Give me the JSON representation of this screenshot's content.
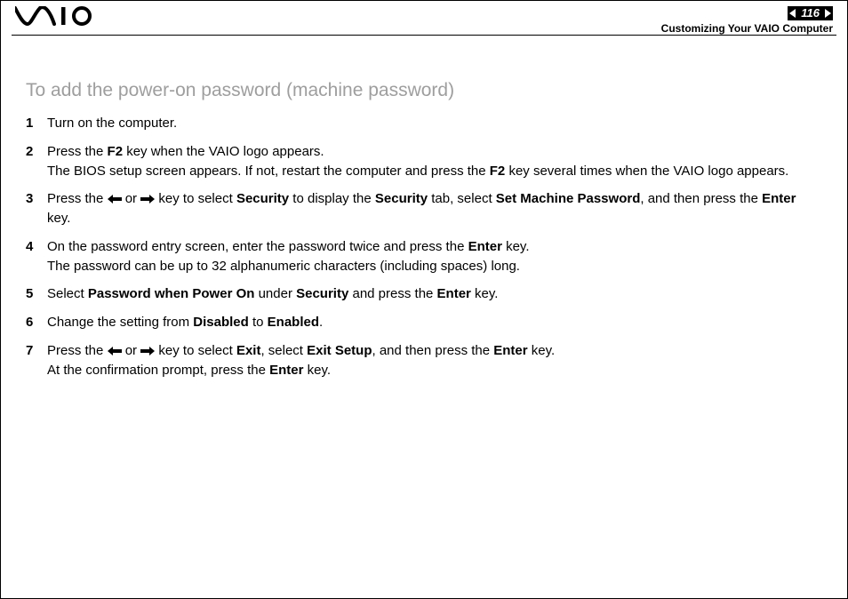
{
  "header": {
    "page_number": "116",
    "section": "Customizing Your VAIO Computer"
  },
  "title": "To add the power-on password (machine password)",
  "steps": {
    "s1": {
      "num": "1",
      "text": "Turn on the computer."
    },
    "s2": {
      "num": "2",
      "line1_a": "Press the ",
      "line1_key": "F2",
      "line1_b": " key when the VAIO logo appears.",
      "line2_a": "The BIOS setup screen appears. If not, restart the computer and press the ",
      "line2_key": "F2",
      "line2_b": " key several times when the VAIO logo appears."
    },
    "s3": {
      "num": "3",
      "a": "Press the ",
      "or": " or ",
      "b": " key to select ",
      "k1": "Security",
      "c": " to display the ",
      "k2": "Security",
      "d": " tab, select ",
      "k3": "Set Machine Password",
      "e": ", and then press the ",
      "k4": "Enter",
      "f": " key."
    },
    "s4": {
      "num": "4",
      "a": "On the password entry screen, enter the password twice and press the ",
      "k1": "Enter",
      "b": " key.",
      "c": "The password can be up to 32 alphanumeric characters (including spaces) long."
    },
    "s5": {
      "num": "5",
      "a": "Select ",
      "k1": "Password when Power On",
      "b": " under ",
      "k2": "Security",
      "c": " and press the ",
      "k3": "Enter",
      "d": " key."
    },
    "s6": {
      "num": "6",
      "a": "Change the setting from ",
      "k1": "Disabled",
      "b": " to ",
      "k2": "Enabled",
      "c": "."
    },
    "s7": {
      "num": "7",
      "a": "Press the ",
      "or": " or ",
      "b": " key to select ",
      "k1": "Exit",
      "c": ", select ",
      "k2": "Exit Setup",
      "d": ", and then press the ",
      "k3": "Enter",
      "e": " key.",
      "f": "At the confirmation prompt, press the ",
      "k4": "Enter",
      "g": " key."
    }
  }
}
